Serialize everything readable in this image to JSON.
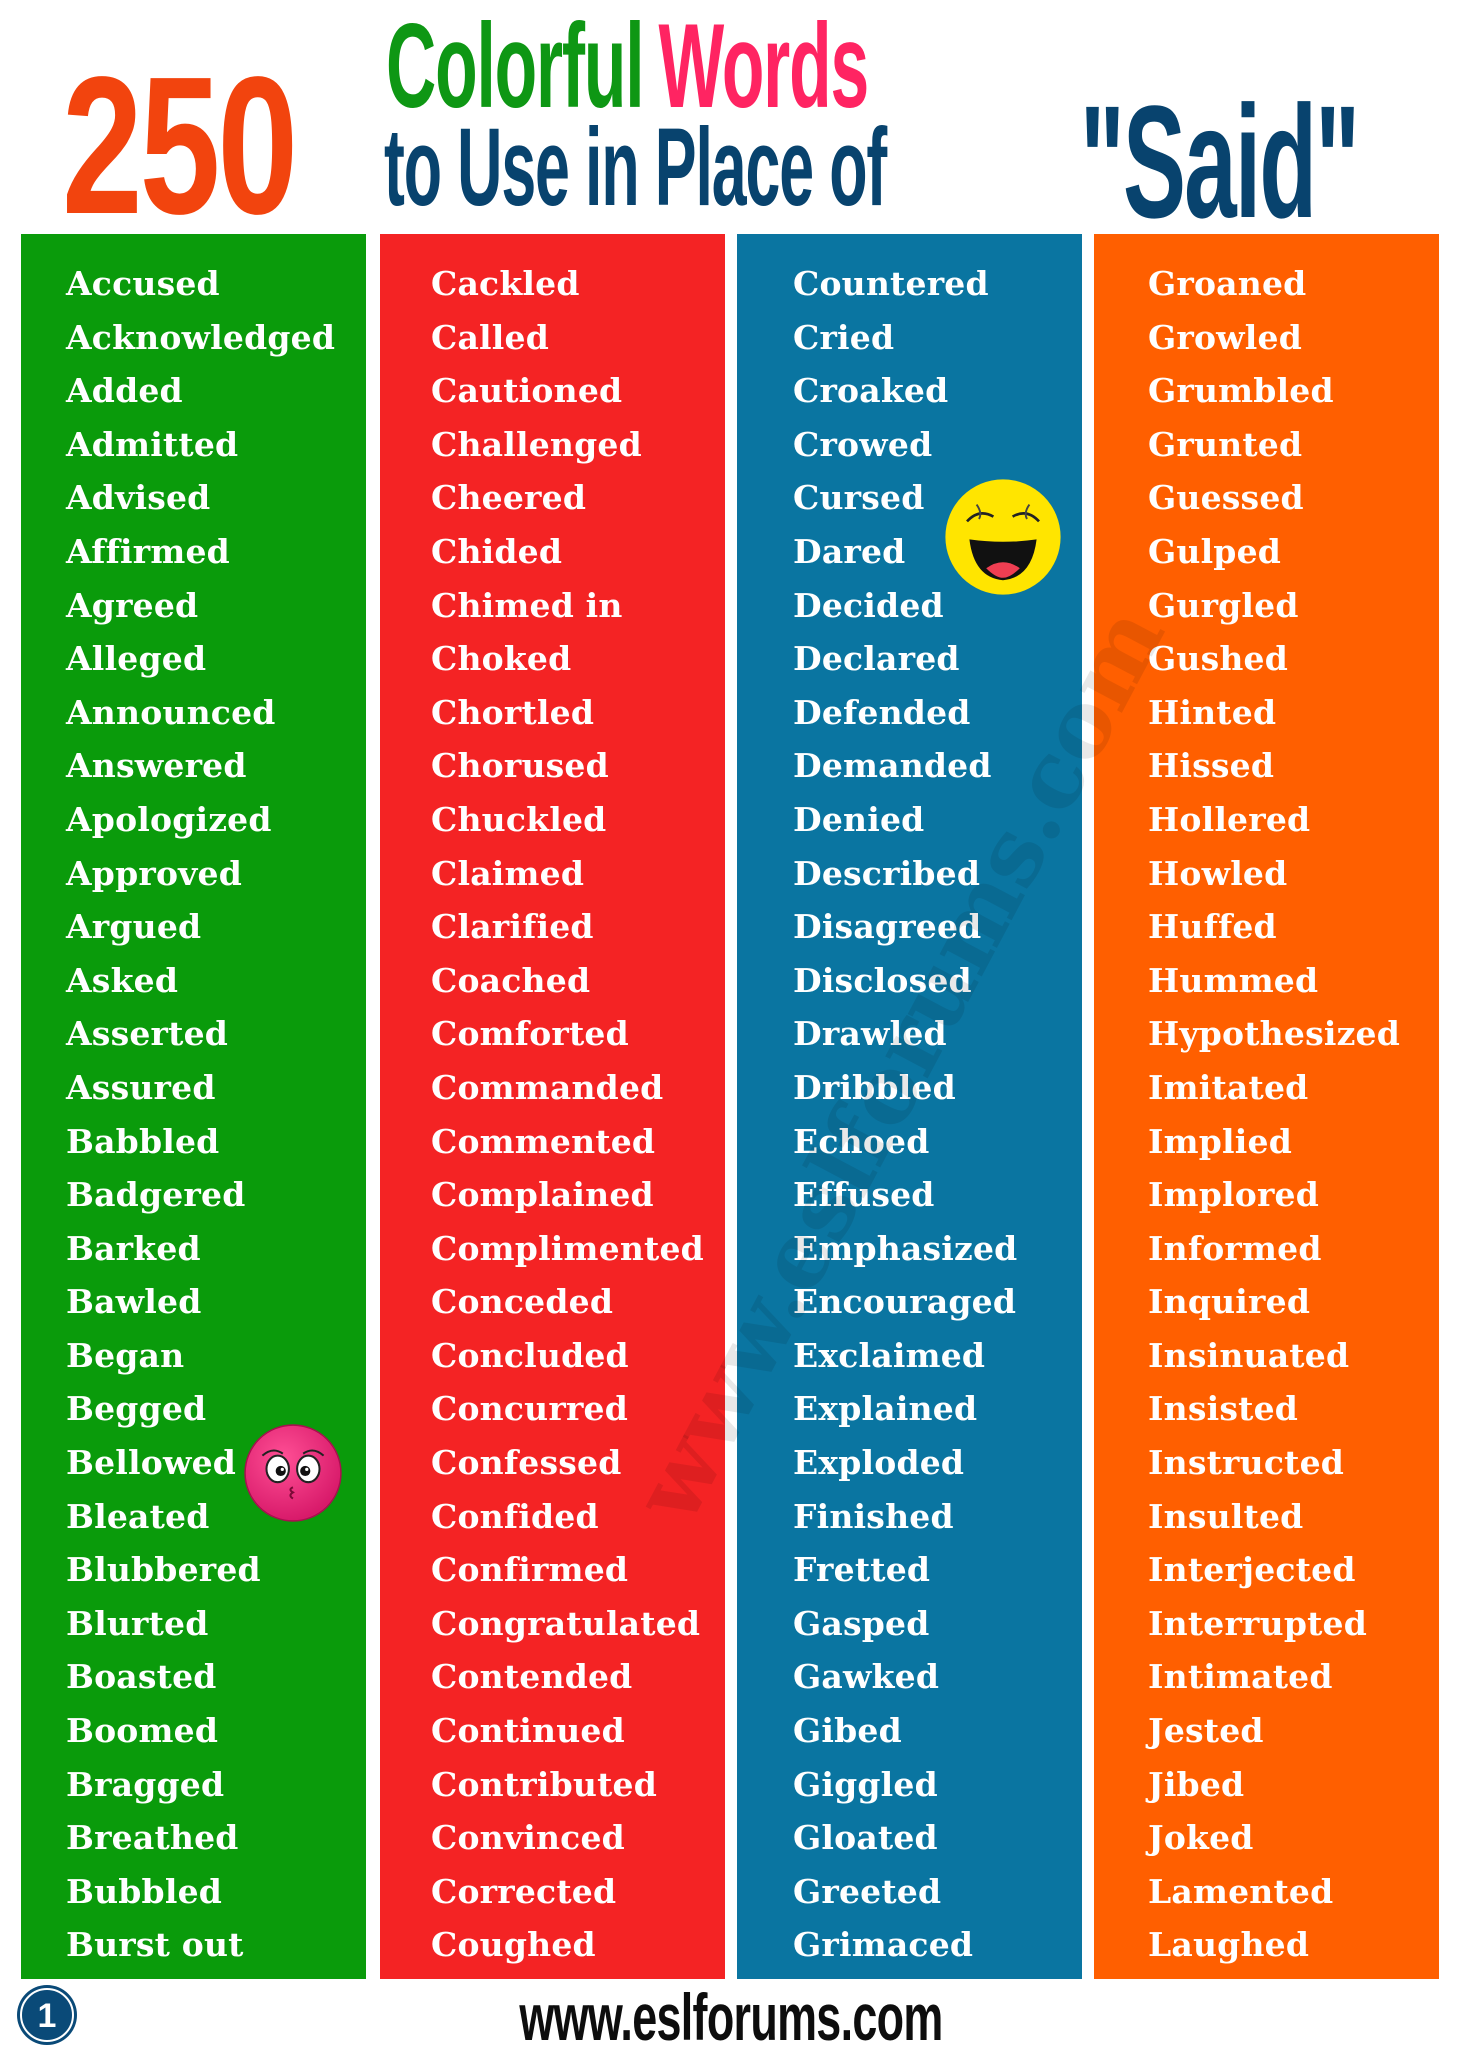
{
  "header": {
    "count": "250",
    "word_colorful": "Colorful",
    "word_words": "Words",
    "line2": "to Use in Place of",
    "said": "\"Said\"",
    "colors": {
      "count": "#f2440e",
      "colorful": "#0e9714",
      "words": "#ff2462",
      "line2": "#08436e",
      "said": "#08436e"
    }
  },
  "columns": [
    {
      "color": "#0a9b0b",
      "words": [
        "Accused",
        "Acknowledged",
        "Added",
        "Admitted",
        "Advised",
        "Affirmed",
        "Agreed",
        "Alleged",
        "Announced",
        "Answered",
        "Apologized",
        "Approved",
        "Argued",
        "Asked",
        "Asserted",
        "Assured",
        "Babbled",
        "Badgered",
        "Barked",
        "Bawled",
        "Began",
        "Begged",
        "Bellowed",
        "Bleated",
        "Blubbered",
        "Blurted",
        "Boasted",
        "Boomed",
        "Bragged",
        "Breathed",
        "Bubbled",
        "Burst out"
      ]
    },
    {
      "color": "#f42324",
      "words": [
        "Cackled",
        "Called",
        "Cautioned",
        "Challenged",
        "Cheered",
        "Chided",
        "Chimed in",
        "Choked",
        "Chortled",
        "Chorused",
        "Chuckled",
        "Claimed",
        "Clarified",
        "Coached",
        "Comforted",
        "Commanded",
        "Commented",
        "Complained",
        "Complimented",
        "Conceded",
        "Concluded",
        "Concurred",
        "Confessed",
        "Confided",
        "Confirmed",
        "Congratulated",
        "Contended",
        "Continued",
        "Contributed",
        "Convinced",
        "Corrected",
        "Coughed"
      ]
    },
    {
      "color": "#0a75a1",
      "words": [
        "Countered",
        "Cried",
        "Croaked",
        "Crowed",
        "Cursed",
        "Dared",
        "Decided",
        "Declared",
        "Defended",
        "Demanded",
        "Denied",
        "Described",
        "Disagreed",
        "Disclosed",
        "Drawled",
        "Dribbled",
        "Echoed",
        "Effused",
        "Emphasized",
        "Encouraged",
        "Exclaimed",
        "Explained",
        "Exploded",
        "Finished",
        "Fretted",
        "Gasped",
        "Gawked",
        "Gibed",
        "Giggled",
        "Gloated",
        "Greeted",
        "Grimaced"
      ]
    },
    {
      "color": "#ff5f00",
      "words": [
        "Groaned",
        "Growled",
        "Grumbled",
        "Grunted",
        "Guessed",
        "Gulped",
        "Gurgled",
        "Gushed",
        "Hinted",
        "Hissed",
        "Hollered",
        "Howled",
        "Huffed",
        "Hummed",
        "Hypothesized",
        "Imitated",
        "Implied",
        "Implored",
        "Informed",
        "Inquired",
        "Insinuated",
        "Insisted",
        "Instructed",
        "Insulted",
        "Interjected",
        "Interrupted",
        "Intimated",
        "Jested",
        "Jibed",
        "Joked",
        "Lamented",
        "Laughed"
      ]
    }
  ],
  "watermark": "www.eslforums.com",
  "emojis": {
    "pink": "kissing-face-pink-icon",
    "laugh": "laughing-face-yellow-icon"
  },
  "footer": {
    "page_number": "1",
    "url": "www.eslforums.com",
    "badge_color": "#0a4a78"
  }
}
